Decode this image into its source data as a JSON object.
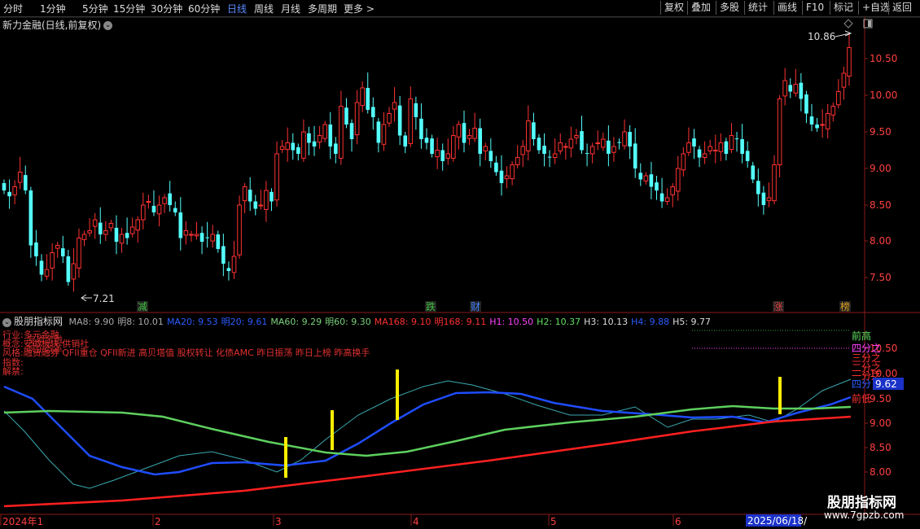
{
  "toolbar": {
    "periods": [
      "分时",
      "1分钟",
      "5分钟",
      "15分钟",
      "30分钟",
      "60分钟",
      "日线",
      "周线",
      "月线",
      "多周期",
      "更多"
    ],
    "more_arrow": ">",
    "right_buttons": [
      "复权",
      "叠加",
      "多股",
      "统计",
      "画线",
      "F10",
      "标记",
      "+自选",
      "返回"
    ]
  },
  "main": {
    "title": "新力金融(日线,前复权)",
    "title_icon": "chevron-down-icon",
    "settings_icon": "window-toggle-icon",
    "diamond_icon": "diamond-icon",
    "price_axis": [
      "10.50",
      "10.00",
      "9.50",
      "9.00",
      "8.50",
      "8.00",
      "7.50"
    ],
    "high_marker": "10.86",
    "low_marker": "7.21",
    "events": [
      {
        "label": "减",
        "color": "#40c040"
      },
      {
        "label": "跌",
        "color": "#40c040"
      },
      {
        "label": "财",
        "color": "#4080ff"
      },
      {
        "label": "涨",
        "color": "#e04040"
      },
      {
        "label": "榜",
        "color": "#e0a020"
      }
    ],
    "colors": {
      "up": "#ff3232",
      "down": "#54ffff",
      "bg": "#000000"
    }
  },
  "indicator": {
    "name": "股朋指标网",
    "values": [
      {
        "text": "MA8: 9.90",
        "color": "#aaaaaa"
      },
      {
        "text": "明8: 10.01",
        "color": "#aaaaaa"
      },
      {
        "text": "MA20: 9.53",
        "color": "#2a5cff"
      },
      {
        "text": "明20: 9.61",
        "color": "#2a5cff"
      },
      {
        "text": "MA60: 9.29",
        "color": "#7ad07a"
      },
      {
        "text": "明60: 9.30",
        "color": "#7ad07a"
      },
      {
        "text": "MA168: 9.10",
        "color": "#ff3030"
      },
      {
        "text": "明168: 9.11",
        "color": "#ff3030"
      },
      {
        "text": "H1: 10.50",
        "color": "#ff40ff"
      },
      {
        "text": "H2: 10.37",
        "color": "#60e060"
      },
      {
        "text": "H3: 10.13",
        "color": "#dddddd"
      },
      {
        "text": "H4: 9.88",
        "color": "#2a5cff"
      },
      {
        "text": "H5: 9.77",
        "color": "#dddddd"
      }
    ],
    "info_lines": [
      {
        "label": "行业:",
        "text": "多元金融"
      },
      {
        "label": "概念:",
        "text": "安徽板块 供销社"
      },
      {
        "label": "风格:",
        "text": "融资融券 QFII重仓 QFII新进 高贝塔值 股权转让 化债AMC 昨日振荡 昨日上榜 昨高换手"
      },
      {
        "label": "指数:",
        "text": ""
      },
      {
        "label": "解禁:",
        "text": ""
      }
    ],
    "overlap_texts": [
      "专项金融",
      "皖企改革"
    ],
    "axis": [
      "10.50",
      "10.00",
      "9.50",
      "9.00",
      "8.50",
      "8.00"
    ],
    "current_value": "9.62",
    "right_labels": [
      {
        "text": "前高",
        "color": "#60e060"
      },
      {
        "text": "四分之",
        "color": "#ff40ff"
      },
      {
        "text": "三分之",
        "color": "#ff3030"
      },
      {
        "text": "二分之",
        "color": "#ff3030"
      },
      {
        "text": "一分之",
        "color": "#ff3030"
      },
      {
        "text": "四分",
        "color": "#2a5cff"
      },
      {
        "text": "前低",
        "color": "#ff3030"
      }
    ],
    "indicator_icon": "chevron-down-icon"
  },
  "date_axis": {
    "labels": [
      "2024年1",
      "2",
      "3",
      "4",
      "5",
      "6"
    ],
    "current_date": "2025/06/18/"
  },
  "watermark": {
    "brand": "股朋指标网",
    "url": "www.7gpzb.com"
  }
}
